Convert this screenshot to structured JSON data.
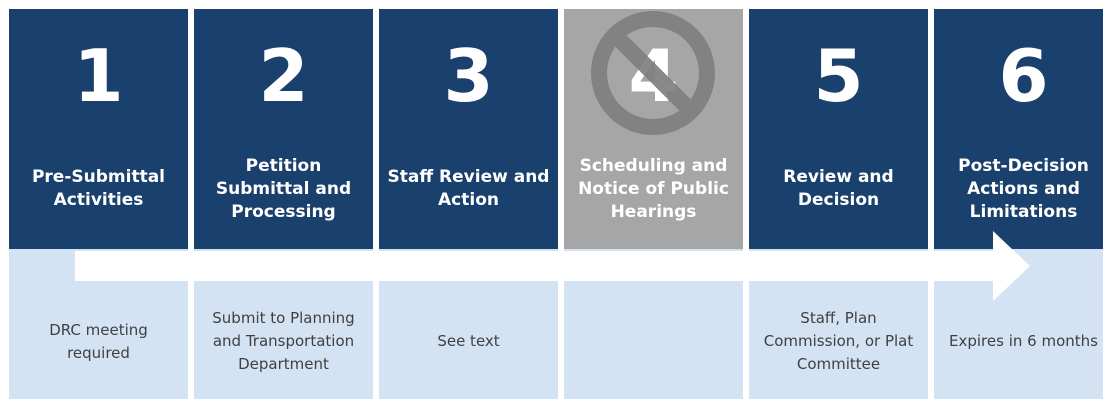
{
  "steps": [
    {
      "number": "1",
      "title": "Pre-Submittal Activities",
      "note": "DRC meeting required",
      "active": true
    },
    {
      "number": "2",
      "title": "Petition Submittal and Processing",
      "note": "Submit to Planning and Transportation Department",
      "active": true
    },
    {
      "number": "3",
      "title": "Staff Review and Action",
      "note": "See text",
      "active": true
    },
    {
      "number": "4",
      "title": "Scheduling and Notice of Public Hearings",
      "note": "",
      "active": false
    },
    {
      "number": "5",
      "title": "Review and Decision",
      "note": "Staff, Plan Commission, or Plat Committee",
      "active": true
    },
    {
      "number": "6",
      "title": "Post-Decision Actions and Limitations",
      "note": "Expires in 6 months",
      "active": true
    }
  ],
  "colors": {
    "active_header": "#1a406d",
    "inactive_header": "#a6a6a6",
    "light_panel": "#d4e3f4",
    "arrow": "#ffffff",
    "no_sign": "#7f7f7f"
  },
  "icons": {
    "step_4_overlay": "no-entry-icon",
    "process_arrow": "right-arrow-icon"
  }
}
